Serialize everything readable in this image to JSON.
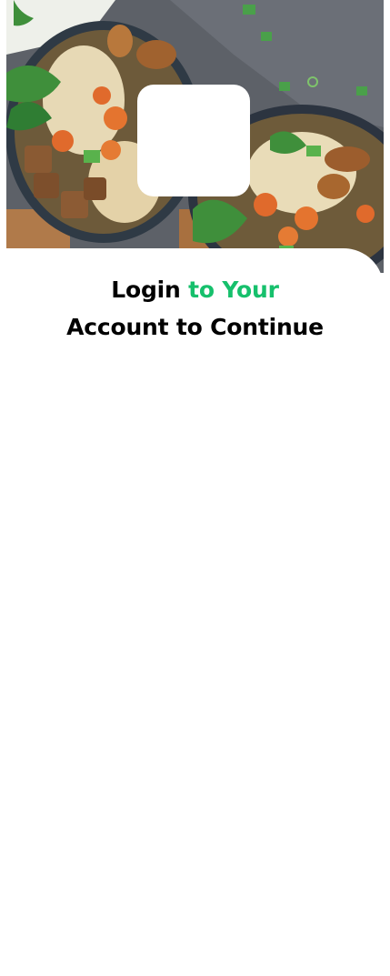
{
  "header": {
    "hero_image": "food-noodle-bowls-photo",
    "logo": "app-logo-placeholder"
  },
  "login": {
    "title_part1": "Login",
    "title_accent": "to Your",
    "title_line2": "Account to Continue"
  },
  "colors": {
    "accent": "#16c06c",
    "background": "#ffffff",
    "text": "#000000"
  }
}
